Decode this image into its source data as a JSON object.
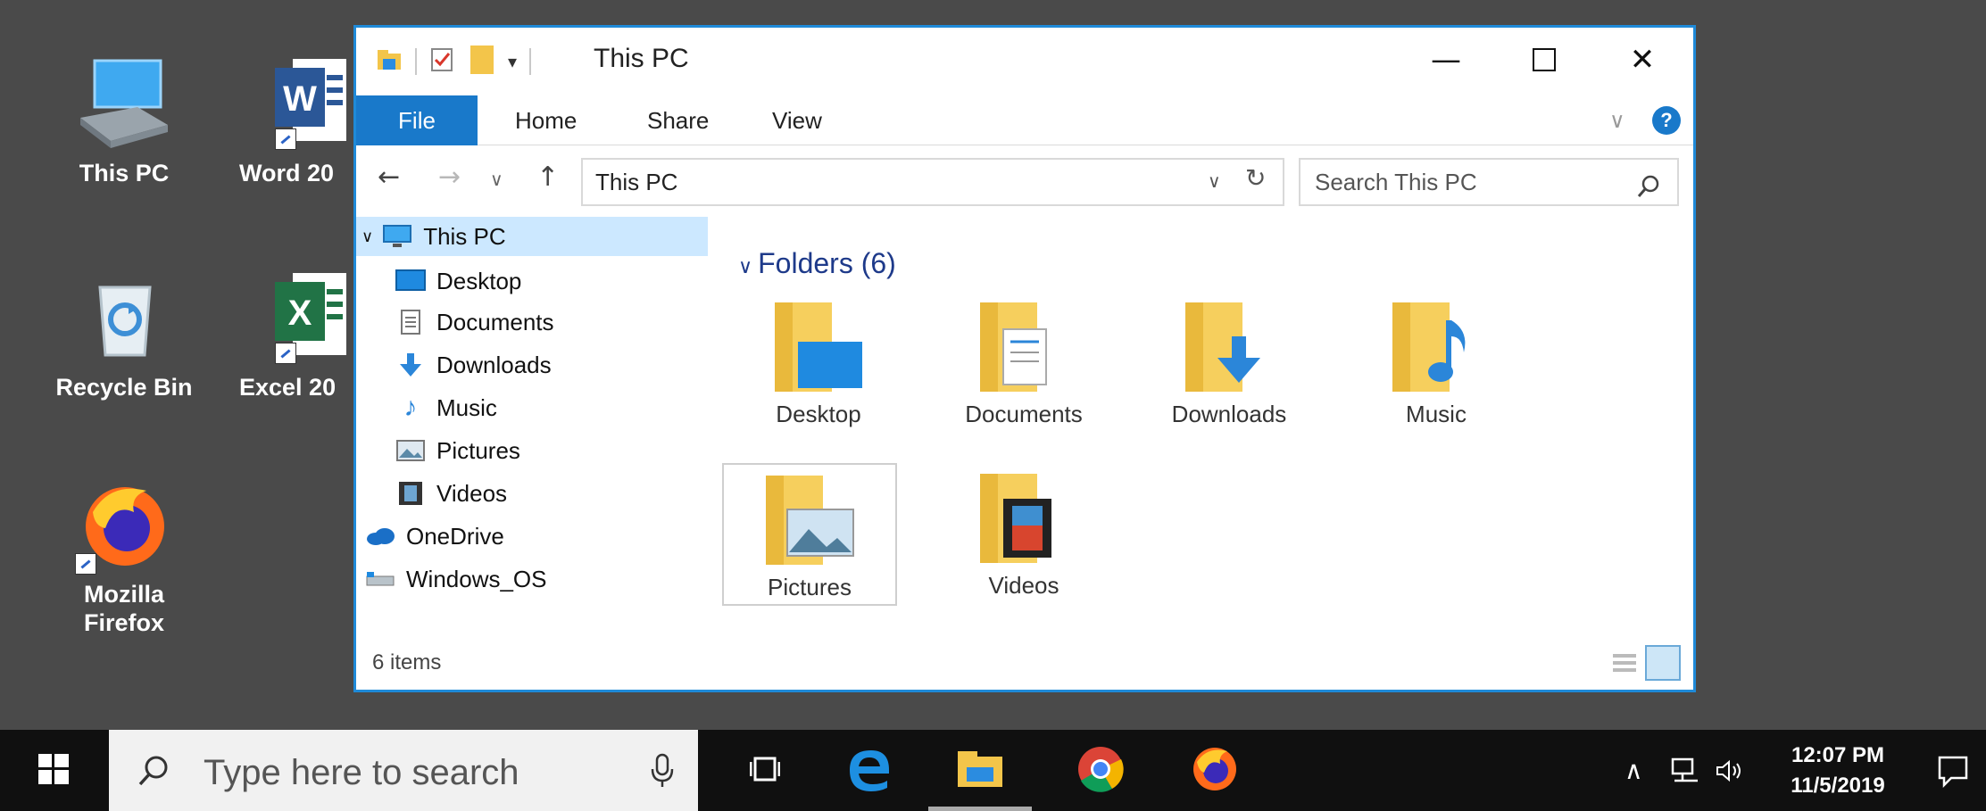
{
  "desktop": {
    "icons": [
      {
        "label": "This PC"
      },
      {
        "label": "Word 20"
      },
      {
        "label": "Recycle Bin"
      },
      {
        "label": "Excel 20"
      },
      {
        "label_line1": "Mozilla",
        "label_line2": "Firefox"
      }
    ]
  },
  "window": {
    "title": "This PC",
    "ribbon_tabs": [
      "File",
      "Home",
      "Share",
      "View"
    ],
    "address": "This PC",
    "search_placeholder": "Search This PC",
    "nav_items": [
      {
        "label": "This PC",
        "icon": "monitor-icon",
        "selected": true
      },
      {
        "label": "Desktop",
        "icon": "desktop-icon"
      },
      {
        "label": "Documents",
        "icon": "documents-icon"
      },
      {
        "label": "Downloads",
        "icon": "downloads-icon"
      },
      {
        "label": "Music",
        "icon": "music-note-icon"
      },
      {
        "label": "Pictures",
        "icon": "pictures-icon"
      },
      {
        "label": "Videos",
        "icon": "videos-icon"
      },
      {
        "label": "OneDrive",
        "icon": "cloud-icon"
      },
      {
        "label": "Windows_OS",
        "icon": "drive-icon"
      }
    ],
    "group_header": "Folders (6)",
    "folders": [
      {
        "label": "Desktop",
        "icon": "desktop-folder-icon"
      },
      {
        "label": "Documents",
        "icon": "documents-folder-icon"
      },
      {
        "label": "Downloads",
        "icon": "downloads-folder-icon"
      },
      {
        "label": "Music",
        "icon": "music-folder-icon"
      },
      {
        "label": "Pictures",
        "icon": "pictures-folder-icon",
        "selected": true
      },
      {
        "label": "Videos",
        "icon": "videos-folder-icon"
      }
    ],
    "status": "6 items",
    "accent_color": "#1979ca",
    "selection_color": "#cce8ff"
  },
  "taskbar": {
    "search_placeholder": "Type here to search",
    "apps": [
      "task-view-icon",
      "edge-icon",
      "file-explorer-icon",
      "chrome-icon",
      "firefox-icon"
    ],
    "time": "12:07 PM",
    "date": "11/5/2019"
  }
}
